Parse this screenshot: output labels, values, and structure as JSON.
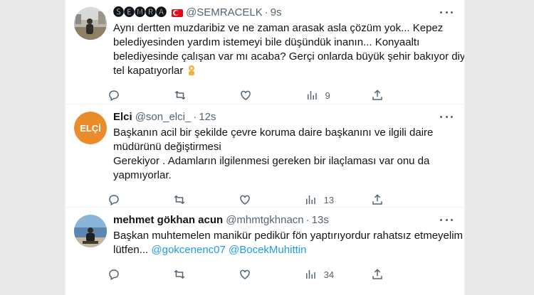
{
  "tweets": [
    {
      "display_name": "🅢🅔🅜🅡🅐",
      "handle": "@SEMRACELK",
      "time": "9s",
      "lines": [
        "Aynı dertten muzdaribiz ve ne zaman arasak asla çözüm yok... Kepez",
        "belediyesinden yardım istemeyi bile düşündük inanın... Konyaaltı",
        "belediyesinde çalışan var mı acaba? Gerçi onlarda büyük şehir bakıyor diye",
        "tel kapatıyorlar"
      ],
      "views": "9"
    },
    {
      "display_name": "Elci",
      "handle": "@son_elci_",
      "time": "12s",
      "avatar_text": "ELÇİ",
      "lines": [
        "Başkanın acil bir şekilde çevre koruma daire başkanını ve ilgili daire",
        "müdürünü değiştirmesi",
        "Gerekiyor . Adamların ilgilenmesi gereken bir ilaçlaması var onu da",
        "yapmıyorlar."
      ],
      "views": "13"
    },
    {
      "display_name": "mehmet gökhan acun",
      "handle": "@mhmtgkhnacn",
      "time": "13s",
      "lines": [
        "Başkan muhtemelen manikür pedikür fön yaptırıyordur rahatsız etmeyelim",
        "lütfen..."
      ],
      "mentions": [
        "@gokcenenc07",
        "@BocekMuhittin"
      ],
      "views": "34"
    }
  ],
  "colors": {
    "accent": "#1d9bf0",
    "muted": "#536471",
    "text": "#0f1419"
  }
}
